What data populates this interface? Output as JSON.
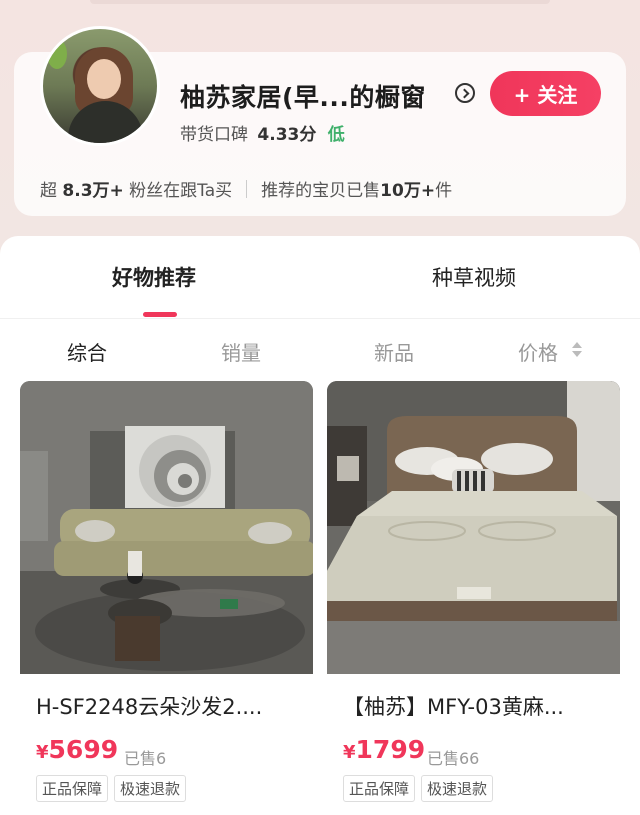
{
  "store": {
    "name": "柚苏家居(早...的橱窗",
    "rating_label": "带货口碑",
    "rating_score": "4.33分",
    "rating_level": "低",
    "follow_label": "+ 关注",
    "stats_prefix": "超",
    "fans_count": "8.3万+",
    "fans_suffix": "粉丝在跟Ta买",
    "sold_prefix": "推荐的宝贝已售",
    "sold_count": "10万+",
    "sold_suffix": "件"
  },
  "tabs": [
    {
      "label": "好物推荐",
      "active": true
    },
    {
      "label": "种草视频",
      "active": false
    }
  ],
  "sort": [
    {
      "label": "综合",
      "active": true
    },
    {
      "label": "销量",
      "active": false
    },
    {
      "label": "新品",
      "active": false
    },
    {
      "label": "价格",
      "active": false,
      "icon": "sort-arrows-icon"
    }
  ],
  "products": [
    {
      "title": "H-SF2248云朵沙发2....",
      "currency": "¥",
      "price": "5699",
      "sold": "已售6",
      "tags": [
        "正品保障",
        "极速退款"
      ],
      "image": "sofa-photo"
    },
    {
      "title": "【柚苏】MFY-03黄麻...",
      "currency": "¥",
      "price": "1799",
      "sold": "已售66",
      "tags": [
        "正品保障",
        "极速退款"
      ],
      "image": "bed-photo"
    }
  ],
  "colors": {
    "accent": "#f0365a",
    "rating_low": "#3fb06b"
  }
}
